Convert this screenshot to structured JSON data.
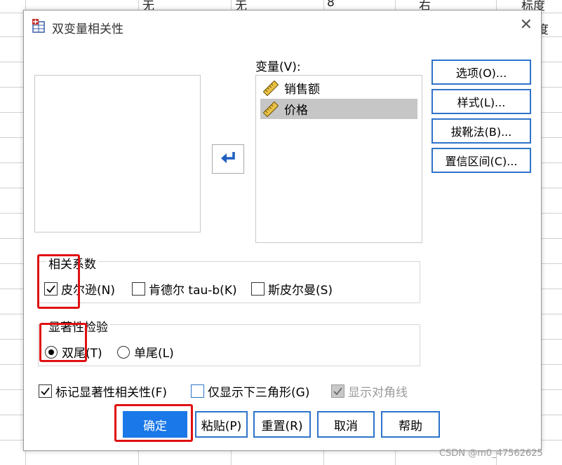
{
  "background": {
    "cells": [
      "无",
      "无",
      "8",
      "右",
      "标度",
      "度"
    ]
  },
  "dialog": {
    "title": "双变量相关性",
    "close_glyph": "✕",
    "variables_label": "变量(V):",
    "variables": [
      {
        "name": "销售额",
        "icon": "ruler-icon",
        "selected": false
      },
      {
        "name": "价格",
        "icon": "ruler-icon",
        "selected": true
      }
    ],
    "side_buttons": [
      "选项(O)...",
      "样式(L)...",
      "拔靴法(B)...",
      "置信区间(C)..."
    ],
    "correlation": {
      "title": "相关系数",
      "options": [
        {
          "label": "皮尔逊(N)",
          "checked": true
        },
        {
          "label": "肯德尔 tau-b(K)",
          "checked": false
        },
        {
          "label": "斯皮尔曼(S)",
          "checked": false
        }
      ]
    },
    "significance": {
      "title": "显著性检验",
      "options": [
        {
          "label": "双尾(T)",
          "selected": true
        },
        {
          "label": "单尾(L)",
          "selected": false
        }
      ]
    },
    "bottom_options": [
      {
        "label": "标记显著性相关性(F)",
        "checked": true,
        "disabled": false
      },
      {
        "label": "仅显示下三角形(G)",
        "checked": false,
        "disabled": false
      },
      {
        "label": "显示对角线",
        "checked": true,
        "disabled": true
      }
    ],
    "buttons": [
      "确定",
      "粘贴(P)",
      "重置(R)",
      "取消",
      "帮助"
    ]
  },
  "watermark": "CSDN @m0_47562625",
  "colors": {
    "accent": "#2e73c9",
    "primary": "#1a78e8",
    "highlight": "#e01010"
  }
}
